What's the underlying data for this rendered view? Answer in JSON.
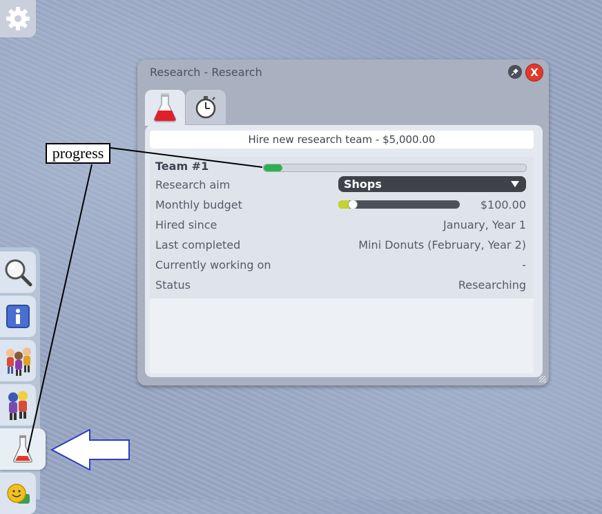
{
  "window": {
    "title": "Research - Research",
    "tabs": [
      {
        "icon": "flask-icon",
        "active": true
      },
      {
        "icon": "stopwatch-icon",
        "active": false
      }
    ],
    "close_label": "X"
  },
  "hire_button": "Hire new research team - $5,000.00",
  "team": {
    "name": "Team #1",
    "progress": 0.07,
    "rows": {
      "research_aim": {
        "label": "Research aim",
        "value": "Shops"
      },
      "monthly_budget": {
        "label": "Monthly budget",
        "value": "$100.00",
        "slider_level": 0.09
      },
      "hired_since": {
        "label": "Hired since",
        "value": "January, Year 1"
      },
      "last_completed": {
        "label": "Last completed",
        "value": "Mini Donuts (February, Year 2)"
      },
      "currently_working_on": {
        "label": "Currently working on",
        "value": "-"
      },
      "status": {
        "label": "Status",
        "value": "Researching"
      }
    }
  },
  "toolbar": {
    "items": [
      "magnifier-icon",
      "info-icon",
      "guests-icon",
      "staff-icon",
      "research-flask-icon",
      "smiley-icon"
    ],
    "active": "research-flask-icon"
  },
  "annotation": {
    "label": "progress"
  },
  "colors": {
    "progress": "#2bb04f",
    "slider": "#c5d32a",
    "close": "#e0392b",
    "dropdown_bg": "#3f424b"
  }
}
